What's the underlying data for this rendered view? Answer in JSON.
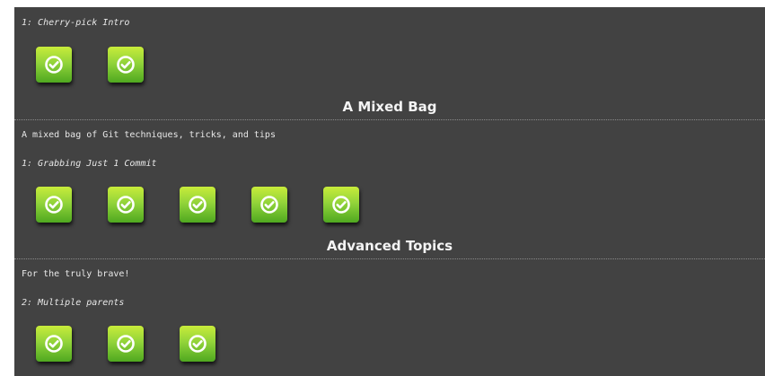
{
  "sections": [
    {
      "title": "",
      "description": "",
      "subheading": "1: Cherry-pick Intro",
      "levels": [
        {
          "status": "completed",
          "icon": "check-circle-icon"
        },
        {
          "status": "completed",
          "icon": "check-circle-icon"
        }
      ]
    },
    {
      "title": "A Mixed Bag",
      "description": "A mixed bag of Git techniques, tricks, and tips",
      "subheading": "1: Grabbing Just 1 Commit",
      "levels": [
        {
          "status": "completed",
          "icon": "check-circle-icon"
        },
        {
          "status": "completed",
          "icon": "check-circle-icon"
        },
        {
          "status": "completed",
          "icon": "check-circle-icon"
        },
        {
          "status": "completed",
          "icon": "check-circle-icon"
        },
        {
          "status": "completed",
          "icon": "check-circle-icon"
        }
      ]
    },
    {
      "title": "Advanced Topics",
      "description": "For the truly brave!",
      "subheading": "2: Multiple parents",
      "levels": [
        {
          "status": "completed",
          "icon": "check-circle-icon"
        },
        {
          "status": "completed",
          "icon": "check-circle-icon"
        },
        {
          "status": "completed",
          "icon": "check-circle-icon"
        }
      ]
    }
  ],
  "colors": {
    "background": "#424242",
    "text": "#e8e8e8",
    "level_complete_top": "#c8ec3a",
    "level_complete_bottom": "#4fa820"
  }
}
